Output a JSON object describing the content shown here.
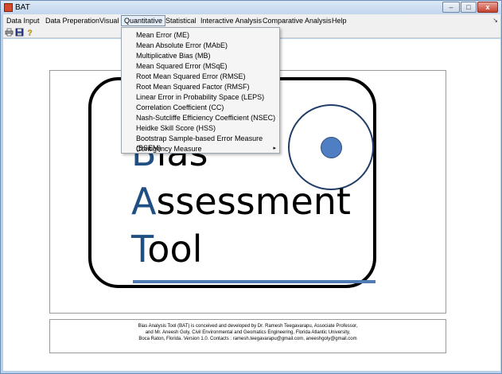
{
  "window": {
    "title": "BAT",
    "min_label": "–",
    "max_label": "□",
    "close_label": "x"
  },
  "menubar": {
    "items": [
      {
        "label": "Data Input"
      },
      {
        "label": "Data Preperation"
      },
      {
        "label": "Visual"
      },
      {
        "label": "Quantitative",
        "active": true
      },
      {
        "label": "Statistical"
      },
      {
        "label": "Interactive Analysis"
      },
      {
        "label": "Comparative Analysis"
      },
      {
        "label": "Help"
      }
    ],
    "edge_glyph": "↘"
  },
  "toolbar": {
    "icons": [
      "print-icon",
      "save-icon",
      "help-icon"
    ]
  },
  "quantitative_menu": {
    "items": [
      {
        "label": "Mean Error (ME)"
      },
      {
        "label": "Mean Absolute Error (MAbE)"
      },
      {
        "label": "Multiplicative Bias (MB)"
      },
      {
        "label": "Mean Squared Error (MSqE)"
      },
      {
        "label": "Root Mean Squared Error (RMSE)"
      },
      {
        "label": "Root Mean Squared Factor (RMSF)"
      },
      {
        "label": "Linear Error in Probability Space (LEPS)"
      },
      {
        "label": "Correlation Coefficient (CC)"
      },
      {
        "label": "Nash-Sutcliffe Efficiency Coefficient (NSEC)"
      },
      {
        "label": "Heidke Skill Score (HSS)"
      },
      {
        "label": "Bootstrap Sample-based Error Measure (BSEM)"
      },
      {
        "label": "Contigency Measure",
        "submenu_arrow": "▸"
      }
    ]
  },
  "logo": {
    "line1_initial": "B",
    "line1_rest": "ias",
    "line2_initial": "A",
    "line2_rest": "ssessment",
    "line3_initial": "T",
    "line3_rest": "ool",
    "accent_color": "#1f4f83"
  },
  "credits": {
    "line1": "Bias Analysis Tool (BAT)  is conceived and developed by Dr. Ramesh Teegavarapu, Associate Professor,",
    "line2": "and Mr. Aneesh Goly, Civil Environmental and Geomatics Engineering, Florida Atlantic University,",
    "line3": "Boca Raton, Florida. Version 1.0. Contacts : ramesh.teegavarapu@gmail.com, aneeshgoly@gmail.com"
  }
}
